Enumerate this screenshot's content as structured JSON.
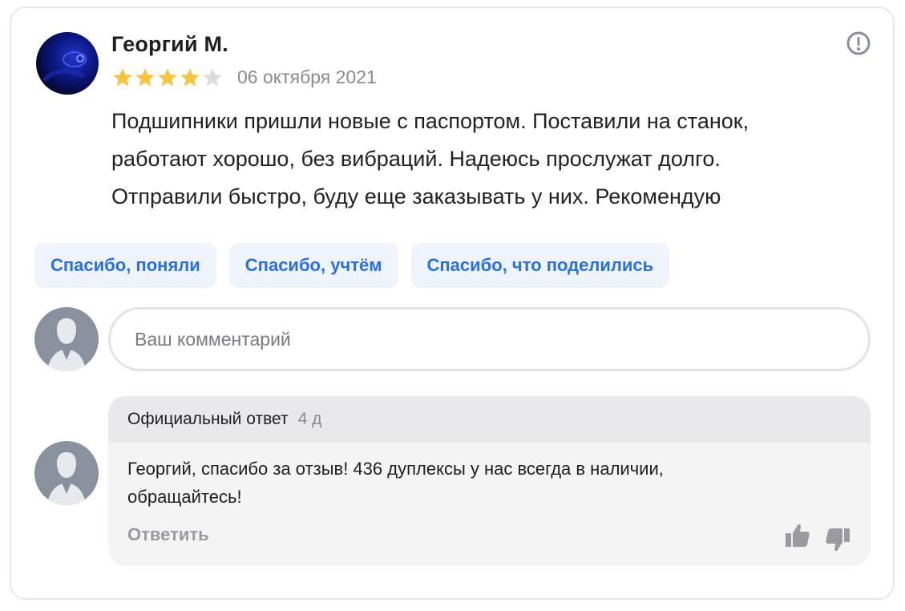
{
  "review": {
    "author": "Георгий М.",
    "rating": 4,
    "rating_max": 5,
    "date": "06 октября 2021",
    "text_lines": [
      "Подшипники пришли новые с паспортом. Поставили на станок,",
      "работают хорошо, без вибраций. Надеюсь прослужат долго.",
      "Отправили быстро, буду еще заказывать у них. Рекомендую"
    ]
  },
  "quick_replies": [
    "Спасибо, поняли",
    "Спасибо, учтём",
    "Спасибо, что поделились"
  ],
  "comment": {
    "placeholder": "Ваш комментарий"
  },
  "official_reply": {
    "header_label": "Официальный ответ",
    "time": "4 д",
    "text_lines": [
      "Георгий, спасибо за отзыв! 436 дуплексы у нас всегда в наличии,",
      "обращайтесь!"
    ],
    "reply_label": "Ответить"
  },
  "colors": {
    "star_filled": "#f6c344",
    "star_empty": "#dcdcdf",
    "link": "#2a6fdb",
    "chip_bg": "#eef3fc"
  },
  "icons": {
    "report": "exclamation-circle-icon",
    "like": "thumbs-up-icon",
    "dislike": "thumbs-down-icon",
    "user": "user-silhouette-icon"
  }
}
